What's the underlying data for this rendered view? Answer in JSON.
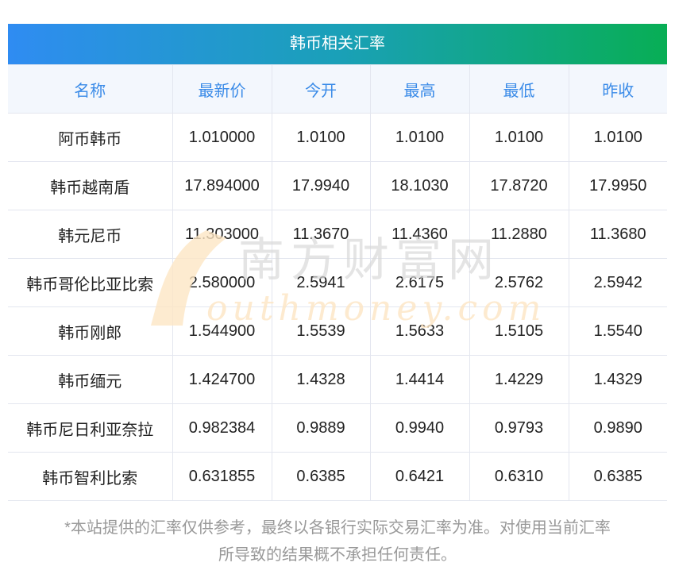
{
  "title": "韩币相关汇率",
  "headers": [
    "名称",
    "最新价",
    "今开",
    "最高",
    "最低",
    "昨收"
  ],
  "rows": [
    [
      "阿币韩币",
      "1.010000",
      "1.0100",
      "1.0100",
      "1.0100",
      "1.0100"
    ],
    [
      "韩币越南盾",
      "17.894000",
      "17.9940",
      "18.1030",
      "17.8720",
      "17.9950"
    ],
    [
      "韩元尼币",
      "11.303000",
      "11.3670",
      "11.4360",
      "11.2880",
      "11.3680"
    ],
    [
      "韩币哥伦比亚比索",
      "2.580000",
      "2.5941",
      "2.6175",
      "2.5762",
      "2.5942"
    ],
    [
      "韩币刚郎",
      "1.544900",
      "1.5539",
      "1.5633",
      "1.5105",
      "1.5540"
    ],
    [
      "韩币缅元",
      "1.424700",
      "1.4328",
      "1.4414",
      "1.4229",
      "1.4329"
    ],
    [
      "韩币尼日利亚奈拉",
      "0.982384",
      "0.9889",
      "0.9940",
      "0.9793",
      "0.9890"
    ],
    [
      "韩币智利比索",
      "0.631855",
      "0.6385",
      "0.6421",
      "0.6310",
      "0.6385"
    ]
  ],
  "watermark": {
    "cn": "南方财富网",
    "en": "southmoney.com"
  },
  "footer": [
    "*本站提供的汇率仅供参考，最终以各银行实际交易汇率为准。对使用当前汇率",
    "所导致的结果概不承担任何责任。"
  ]
}
